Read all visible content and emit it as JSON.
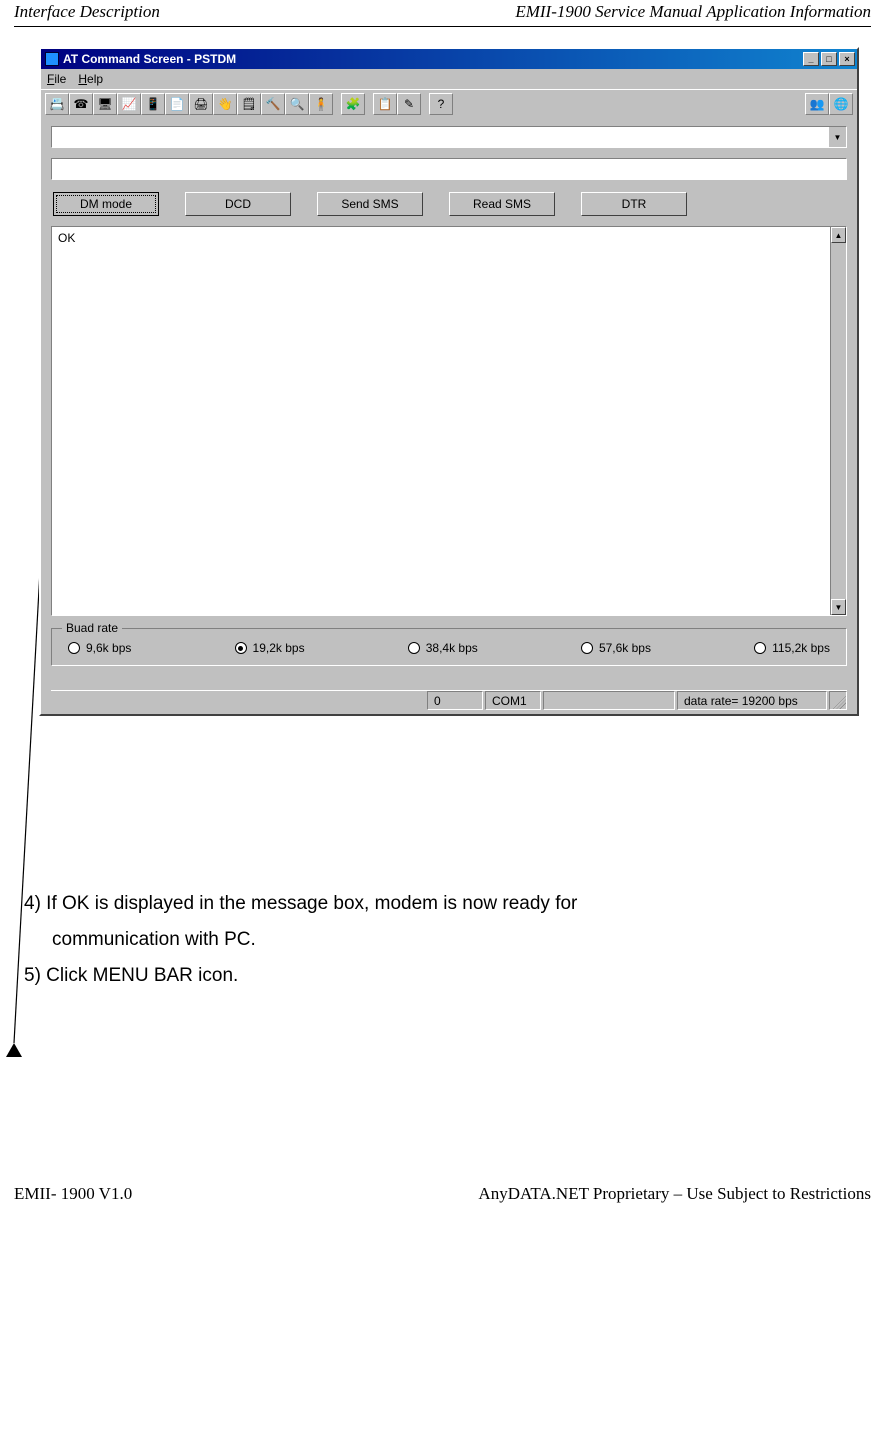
{
  "page": {
    "header_left": "Interface Description",
    "header_right": "EMII-1900 Service Manual Application Information",
    "footer_left": "EMII- 1900 V1.0",
    "footer_right": "AnyDATA.NET Proprietary –  Use Subject to Restrictions"
  },
  "window": {
    "title": "AT Command Screen - PSTDM",
    "btn_min": "_",
    "btn_max": "□",
    "btn_close": "×"
  },
  "menubar": {
    "file_key": "F",
    "file_rest": "ile",
    "help_key": "H",
    "help_rest": "elp"
  },
  "toolbar_icons": {
    "t0": "📇",
    "t1": "☎",
    "t2": "🖥",
    "t3": "📈",
    "t4": "📱",
    "t5": "📄",
    "t6": "🖨",
    "t7": "👋",
    "t8": "🗒",
    "t9": "🔨",
    "t10": "🔍",
    "t11": "🧍",
    "t12": "🧩",
    "t13": "📋",
    "t14": "✎",
    "t15": "?",
    "t16": "👥",
    "t17": "🌐"
  },
  "controls": {
    "combo_value": "",
    "textline_value": ""
  },
  "buttons": {
    "dm": "DM mode",
    "dcd": "DCD",
    "send": "Send SMS",
    "read": "Read SMS",
    "dtr": "DTR"
  },
  "msgbox": {
    "content": "OK"
  },
  "baud": {
    "legend": "Buad rate",
    "opt1": "9,6k bps",
    "opt2": "19,2k bps",
    "opt3": "38,4k bps",
    "opt4": "57,6k bps",
    "opt5": "115,2k bps",
    "selected_index": 1
  },
  "statusbar": {
    "p1": "0",
    "p2": "COM1",
    "p3": "",
    "p4": "data rate= 19200 bps"
  },
  "instructions": {
    "line1": "4)  If  OK  is  displayed  in  the  message  box,  modem  is  now  ready  for",
    "line1b": "communication with PC.",
    "line2": "5) Click MENU BAR icon."
  }
}
